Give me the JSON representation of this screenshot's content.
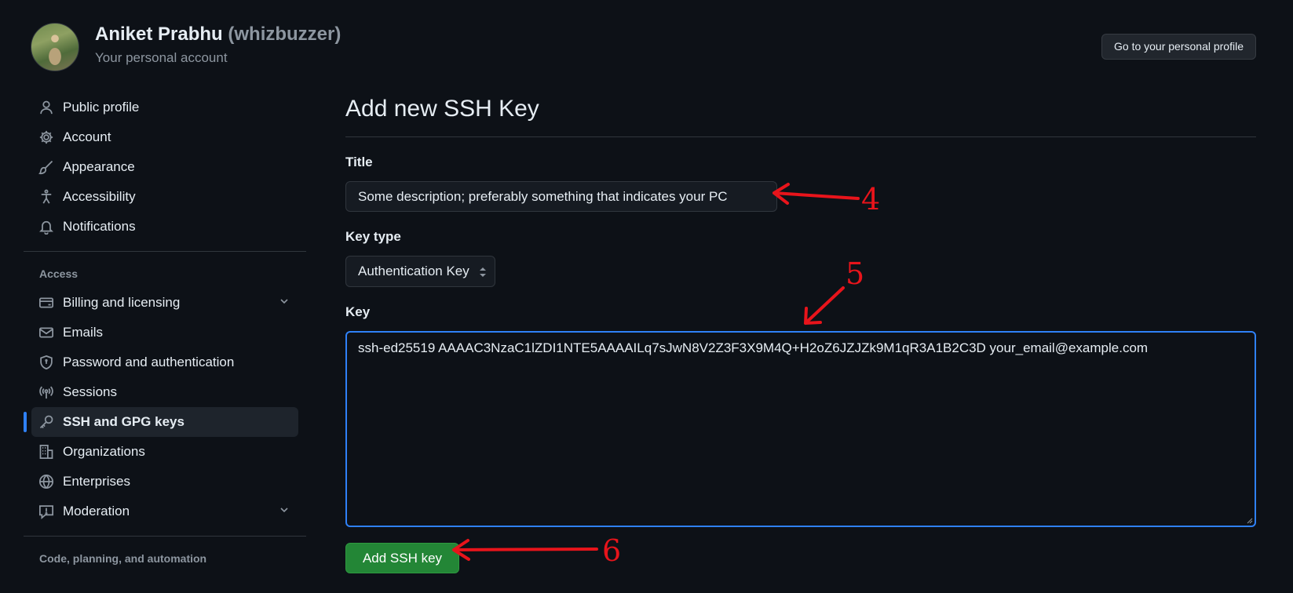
{
  "header": {
    "display_name": "Aniket Prabhu",
    "handle": "(whizbuzzer)",
    "account_type": "Your personal account",
    "profile_button_label": "Go to your personal profile"
  },
  "sidebar": {
    "items": [
      {
        "label": "Public profile",
        "icon": "person-icon"
      },
      {
        "label": "Account",
        "icon": "gear-icon"
      },
      {
        "label": "Appearance",
        "icon": "paintbrush-icon"
      },
      {
        "label": "Accessibility",
        "icon": "accessibility-icon"
      },
      {
        "label": "Notifications",
        "icon": "bell-icon"
      }
    ],
    "access_heading": "Access",
    "access_items": [
      {
        "label": "Billing and licensing",
        "icon": "credit-card-icon",
        "expandable": true
      },
      {
        "label": "Emails",
        "icon": "mail-icon"
      },
      {
        "label": "Password and authentication",
        "icon": "shield-lock-icon"
      },
      {
        "label": "Sessions",
        "icon": "broadcast-icon"
      },
      {
        "label": "SSH and GPG keys",
        "icon": "key-icon",
        "active": true
      },
      {
        "label": "Organizations",
        "icon": "organization-icon"
      },
      {
        "label": "Enterprises",
        "icon": "globe-icon"
      },
      {
        "label": "Moderation",
        "icon": "report-icon",
        "expandable": true
      }
    ],
    "code_heading": "Code, planning, and automation"
  },
  "main": {
    "title": "Add new SSH Key",
    "title_field": {
      "label": "Title",
      "value": "Some description; preferably something that indicates your PC"
    },
    "key_type": {
      "label": "Key type",
      "selected": "Authentication Key"
    },
    "key_field": {
      "label": "Key",
      "value": "ssh-ed25519 AAAAC3NzaC1lZDI1NTE5AAAAILq7sJwN8V2Z3F3X9M4Q+H2oZ6JZJZk9M1qR3A1B2C3D your_email@example.com"
    },
    "submit_label": "Add SSH key"
  },
  "annotations": {
    "step_title": "4",
    "step_key": "5",
    "step_submit": "6",
    "color": "#e8141b"
  },
  "colors": {
    "background": "#0d1117",
    "accent": "#2f81f7",
    "primary_button": "#238636"
  }
}
